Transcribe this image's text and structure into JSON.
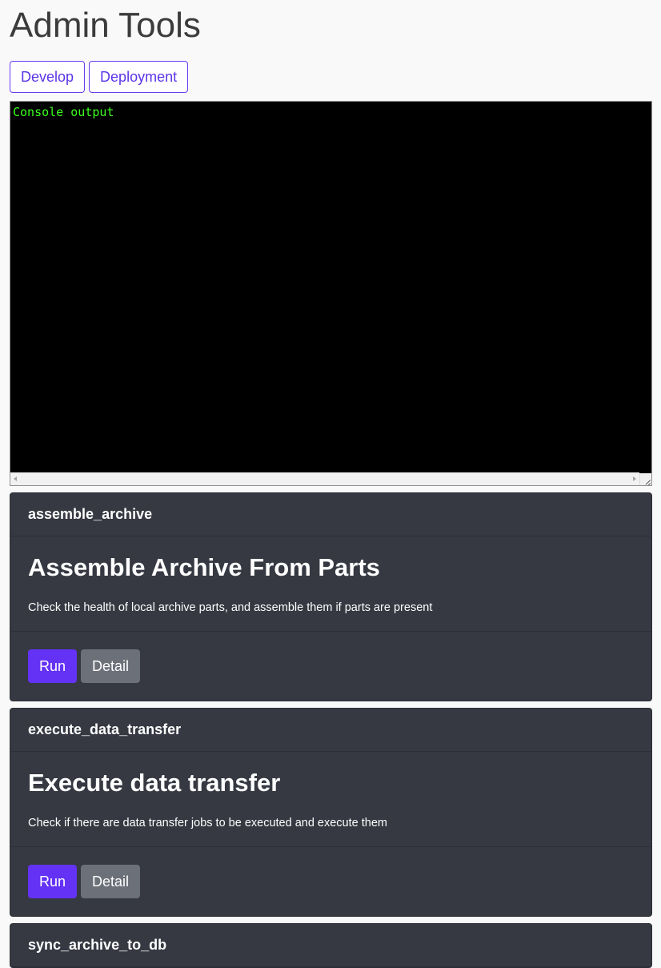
{
  "page": {
    "title": "Admin Tools"
  },
  "tabs": [
    {
      "label": "Develop"
    },
    {
      "label": "Deployment"
    }
  ],
  "console": {
    "text": "Console output"
  },
  "tasks": [
    {
      "id": "assemble_archive",
      "title": "Assemble Archive From Parts",
      "description": "Check the health of local archive parts, and assemble them if parts are present",
      "run_label": "Run",
      "detail_label": "Detail"
    },
    {
      "id": "execute_data_transfer",
      "title": "Execute data transfer",
      "description": "Check if there are data transfer jobs to be executed and execute them",
      "run_label": "Run",
      "detail_label": "Detail"
    },
    {
      "id": "sync_archive_to_db"
    }
  ],
  "colors": {
    "accent": "#6432f5",
    "card_background": "#363942",
    "console_text": "#3cff1f"
  }
}
